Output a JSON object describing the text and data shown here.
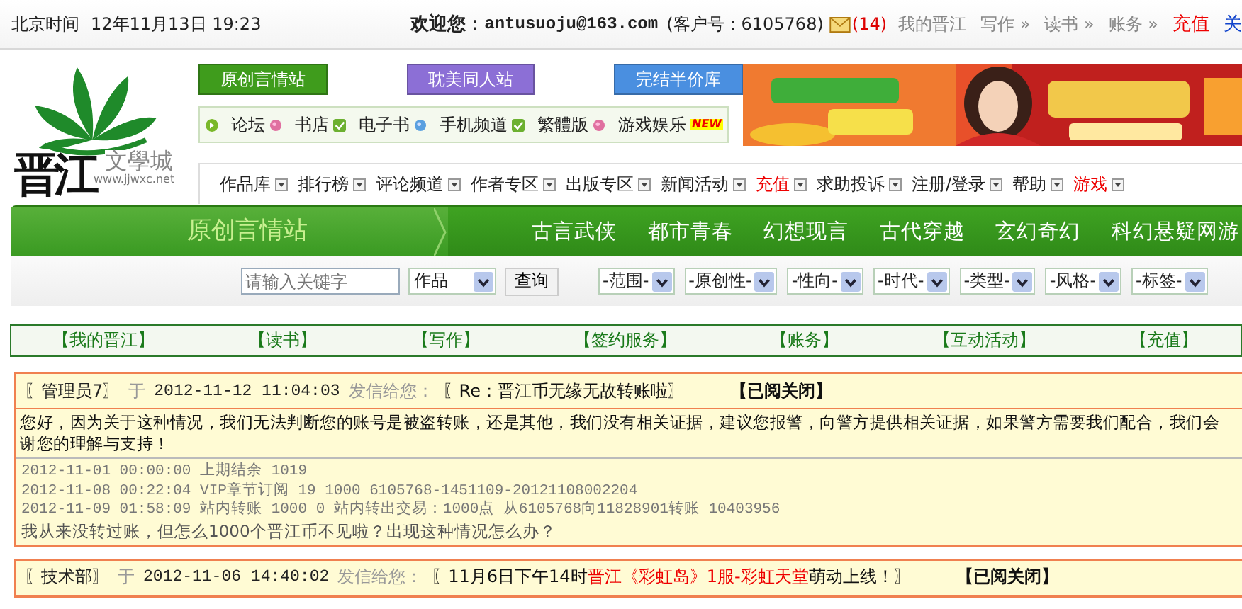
{
  "top_bar": {
    "time_label": "北京时间",
    "datetime": "12年11月13日 19:23",
    "welcome": "欢迎您：",
    "email": "antusuoju@163.com",
    "customer": "(客户号：6105768)",
    "mail_count": "(14)",
    "links": [
      {
        "label": "我的晋江",
        "highlight": false
      },
      {
        "label": "写作 »",
        "highlight": false
      },
      {
        "label": "读书 »",
        "highlight": false
      },
      {
        "label": "账务 »",
        "highlight": false
      },
      {
        "label": "充值",
        "highlight": true
      },
      {
        "label": "关",
        "kind": "blue"
      }
    ]
  },
  "logo": {
    "name": "文學城",
    "url": "www.jjwxc.net",
    "brand": "晋江"
  },
  "site_buttons": [
    {
      "label": "原创言情站",
      "color": "#3f9c1c"
    },
    {
      "label": "耽美同人站",
      "color": "#8c6fd6"
    },
    {
      "label": "完结半价库",
      "color": "#4a8fe0"
    }
  ],
  "quick_links": [
    {
      "label": "论坛",
      "kind": "pink-dot"
    },
    {
      "label": "书店",
      "kind": "check"
    },
    {
      "label": "电子书",
      "kind": "blue-dot"
    },
    {
      "label": "手机频道",
      "kind": "check"
    },
    {
      "label": "繁體版",
      "kind": "pink-dot"
    },
    {
      "label": "游戏娱乐",
      "kind": "new",
      "badge": "NEW"
    }
  ],
  "nav": [
    {
      "label": "作品库",
      "highlight": false
    },
    {
      "label": "排行榜",
      "highlight": false
    },
    {
      "label": "评论频道",
      "highlight": false
    },
    {
      "label": "作者专区",
      "highlight": false
    },
    {
      "label": "出版专区",
      "highlight": false
    },
    {
      "label": "新闻活动",
      "highlight": false
    },
    {
      "label": "充值",
      "highlight": true
    },
    {
      "label": "求助投诉",
      "highlight": false
    },
    {
      "label": "注册/登录",
      "highlight": false
    },
    {
      "label": "帮助",
      "highlight": false
    },
    {
      "label": "游戏",
      "highlight": true
    }
  ],
  "channel_bar": {
    "title": "原创言情站",
    "items": [
      "古言武侠",
      "都市青春",
      "幻想现言",
      "古代穿越",
      "玄幻奇幻",
      "科幻悬疑网游"
    ]
  },
  "search": {
    "placeholder": "请输入关键字",
    "category": "作品",
    "button": "查询",
    "filters": [
      "-范围-",
      "-原创性-",
      "-性向-",
      "-时代-",
      "-类型-",
      "-风格-",
      "-标签-"
    ]
  },
  "sub_nav": [
    "【我的晋江】",
    "【读书】",
    "【写作】",
    "【签约服务】",
    "【账务】",
    "【互动活动】",
    "【充值】"
  ],
  "messages": [
    {
      "sender": "〖管理员7〗",
      "at": "于",
      "time": "2012-11-12 11:04:03",
      "to_label": "发信给您：",
      "subject": [
        {
          "text": "〖Re：晋江币无缘无故转账啦〗",
          "highlight": false
        }
      ],
      "status": "【已阅关闭】",
      "body": [
        "您好，因为关于这种情况，我们无法判断您的账号是被盗转账，还是其他，我们没有相关证据，建议您报警，向警方提供相关证据，如果警方需要我们配合，我们会",
        "谢您的理解与支持！"
      ],
      "records": [
        "2012-11-01 00:00:00 上期结余 1019",
        "2012-11-08 00:22:04 VIP章节订阅 19 1000 6105768-1451109-20121108002204",
        "2012-11-09 01:58:09 站内转账 1000 0 站内转出交易：1000点 从6105768向11828901转账 10403956"
      ],
      "question": "我从来没转过账，但怎么1000个晋江币不见啦？出现这种情况怎么办？"
    },
    {
      "sender": "〖技术部〗",
      "at": "于",
      "time": "2012-11-06 14:40:02",
      "to_label": "发信给您：",
      "subject": [
        {
          "text": "〖11月6日下午14时",
          "highlight": false
        },
        {
          "text": "晋江《彩虹岛》1服-彩虹天堂",
          "highlight": true
        },
        {
          "text": "萌动上线！〗",
          "highlight": false
        }
      ],
      "status": "【已阅关闭】"
    }
  ]
}
